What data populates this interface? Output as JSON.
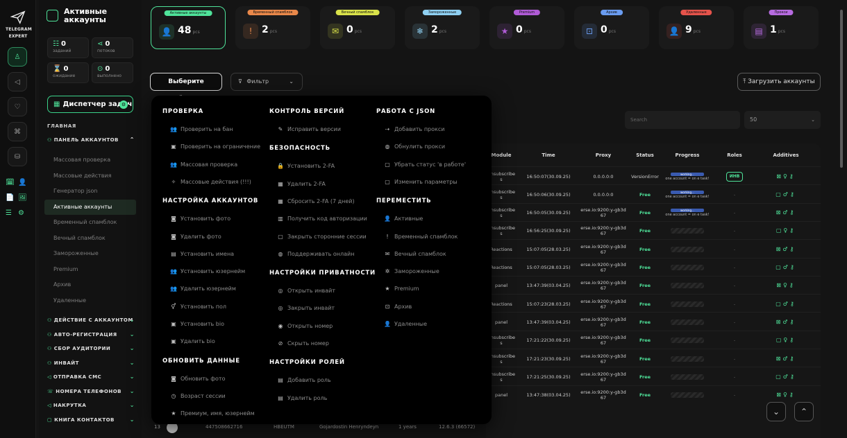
{
  "rail": {
    "logo_text": [
      "TELEGRAM",
      "EXPERT"
    ],
    "mini_left": [
      "🗓",
      "📄",
      "☰"
    ],
    "mini_right": [
      "👤",
      "🖼",
      "⚙"
    ]
  },
  "sidebar": {
    "title_line1": "Активные",
    "title_line2": "аккаунты",
    "stats": [
      {
        "icon": "☷",
        "value": "0",
        "label": "заданий"
      },
      {
        "icon": "⋖",
        "value": "0",
        "label": "потоков"
      },
      {
        "icon": "⌛",
        "value": "0",
        "label": "ожидание"
      },
      {
        "icon": "⊙",
        "value": "0",
        "label": "выполнено"
      }
    ],
    "dispatcher": "Диспетчер задач",
    "dispatcher_badge": "⚙",
    "section_main": "ГЛАВНАЯ",
    "panel_group": "ПАНЕЛЬ АККАУНТОВ",
    "panel_items": [
      "Массовая проверка",
      "Массовые действия",
      "Генератор json",
      "Активные аккаунты",
      "Временный спамблок",
      "Вечный спамблок",
      "Замороженные",
      "Premium",
      "Архив",
      "Удаленные"
    ],
    "groups": [
      "ДЕЙСТВИЕ С АККАУНТОМ",
      "АВТО-РЕГИСТРАЦИЯ",
      "СБОР АУДИТОРИИ",
      "ИНВАЙТ",
      "ОТПРАВКА СМС",
      "НОМЕРА ТЕЛЕФОНОВ",
      "НАКРУТКА",
      "КНИГА КОНТАКТОВ"
    ]
  },
  "cards": [
    {
      "label": "Активные аккаунты",
      "count": "48",
      "unit": "pcs",
      "color": "#4fe39a",
      "icon": "👤"
    },
    {
      "label": "Временный спамблок",
      "count": "2",
      "unit": "pcs",
      "color": "#e9884a",
      "icon": "!"
    },
    {
      "label": "Вечный спамблок",
      "count": "0",
      "unit": "pcs",
      "color": "#d9e24a",
      "icon": "✉"
    },
    {
      "label": "Замороженные",
      "count": "2",
      "unit": "pcs",
      "color": "#8fd0f2",
      "icon": "❄"
    },
    {
      "label": "Premium",
      "count": "0",
      "unit": "pcs",
      "color": "#b05bd6",
      "icon": "★"
    },
    {
      "label": "Архив",
      "count": "0",
      "unit": "pcs",
      "color": "#6a9cf0",
      "icon": "⊡"
    },
    {
      "label": "Удаленные",
      "count": "9",
      "unit": "pcs",
      "color": "#e5534b",
      "icon": "👤"
    },
    {
      "label": "Прокси",
      "count": "1",
      "unit": "pcs",
      "color": "#b76be0",
      "icon": "▤"
    }
  ],
  "toolbar": {
    "action": "Выберите действие",
    "filter": "Фильтр",
    "upload": "Загрузить аккаунты",
    "search_placeholder": "Search",
    "per_page": "50"
  },
  "table": {
    "headers": [
      "Module",
      "Time",
      "Proxy",
      "Status",
      "Progress",
      "Roles",
      "Additives"
    ],
    "rows": [
      {
        "module": "Unsubscribe s",
        "time": "16:50:07(30.09.25)",
        "proxy": "0.0.0.0:0",
        "status": "VersionError",
        "progress": "working",
        "role": "ИНВ"
      },
      {
        "module": "Unsubscribe s",
        "time": "16:50:06(30.09.25)",
        "proxy": "0.0.0.0:0",
        "status": "Free",
        "progress": "working",
        "role": "-"
      },
      {
        "module": "Unsubscribe s",
        "time": "16:50:05(30.09.25)",
        "proxy": "erse.io:9200:y-gb3d 67",
        "status": "Free",
        "progress": "working",
        "role": "-"
      },
      {
        "module": "Unsubscribe s",
        "time": "16:56:25(30.09.25)",
        "proxy": "erse.io:9200:y-gb3d 67",
        "status": "Free",
        "progress": "",
        "role": "-"
      },
      {
        "module": "Reactions",
        "time": "15:07:05(28.03.25)",
        "proxy": "erse.io:9200:y-gb3d 67",
        "status": "Free",
        "progress": "",
        "role": "-"
      },
      {
        "module": "Reactions",
        "time": "15:07:05(28.03.25)",
        "proxy": "erse.io:9200:y-gb3d 67",
        "status": "Free",
        "progress": "",
        "role": "-"
      },
      {
        "module": "panel",
        "time": "13:47:39(03.04.25)",
        "proxy": "erse.io:9200:y-gb3d 67",
        "status": "Free",
        "progress": "",
        "role": "-"
      },
      {
        "module": "Reactions",
        "time": "15:07:23(28.03.25)",
        "proxy": "erse.io:9200:y-gb3d 67",
        "status": "Free",
        "progress": "",
        "role": "-"
      },
      {
        "module": "panel",
        "time": "13:47:39(03.04.25)",
        "proxy": "erse.io:9200:y-gb3d 67",
        "status": "Free",
        "progress": "",
        "role": "-"
      },
      {
        "module": "Unsubscribe s",
        "time": "17:21:22(30.09.25)",
        "proxy": "erse.io:9200:y-gb3d 67",
        "status": "Free",
        "progress": "",
        "role": "-"
      },
      {
        "module": "Unsubscribe s",
        "time": "17:21:23(30.09.25)",
        "proxy": "erse.io:9200:y-gb3d 67",
        "status": "Free",
        "progress": "",
        "role": "-"
      },
      {
        "module": "Unsubscribe s",
        "time": "17:21:25(30.09.25)",
        "proxy": "erse.io:9200:y-gb3d 67",
        "status": "Free",
        "progress": "",
        "role": "-"
      },
      {
        "module": "panel",
        "time": "13:47:38(03.04.25)",
        "proxy": "erse.io:9200:y-gb3d 67",
        "status": "Free",
        "progress": "",
        "role": "-"
      }
    ],
    "working_label": "working...",
    "working_text": "one account = on e task!",
    "last_row": {
      "num": "13",
      "id": "447508662716",
      "code": "HBEUTM",
      "name": "Gojardostin Henryndeyn",
      "age": "1 years",
      "version": "12.6.3 (66572)"
    }
  },
  "menu": {
    "columns": [
      {
        "sections": [
          {
            "title": "ПРОВЕРКА",
            "items": [
              [
                "Проверить на бан",
                "👥"
              ],
              [
                "Проверить на ограничение",
                "▣"
              ],
              [
                "Массовая проверка",
                "👥"
              ],
              [
                "Массовые действия (!!!)",
                "✧"
              ]
            ]
          },
          {
            "title": "НАСТРОЙКА АККАУНТОВ",
            "items": [
              [
                "Установить фото",
                "◙"
              ],
              [
                "Удалить фото",
                "◙"
              ],
              [
                "Установить имена",
                "▤"
              ],
              [
                "Установить юзернейм",
                "👥"
              ],
              [
                "Удалить юзернейм",
                "👥"
              ],
              [
                "Установить пол",
                "⚥"
              ],
              [
                "Установить bio",
                "▣"
              ],
              [
                "Удалить bio",
                "▣"
              ]
            ]
          },
          {
            "title": "ОБНОВИТЬ ДАННЫЕ",
            "items": [
              [
                "Обновить фото",
                "◙"
              ],
              [
                "Возраст сессии",
                "◷"
              ],
              [
                "Премиум, имя, юзернейм",
                "★"
              ]
            ]
          }
        ]
      },
      {
        "sections": [
          {
            "title": "КОНТРОЛЬ ВЕРСИЙ",
            "items": [
              [
                "Исправить версии",
                "✎"
              ]
            ]
          },
          {
            "title": "БЕЗОПАСНОСТЬ",
            "items": [
              [
                "Установить 2-FA",
                "🔒"
              ],
              [
                "Удалить 2-FA",
                "▦"
              ],
              [
                "Сбросить 2-FA (7 дней)",
                "▦"
              ],
              [
                "Получить код авторизации",
                "▥"
              ],
              [
                "Закрыть сторонние сессии",
                "▢"
              ],
              [
                "Поддерживать онлайн",
                "◍"
              ]
            ]
          },
          {
            "title": "НАСТРОЙКИ ПРИВАТНОСТИ",
            "items": [
              [
                "Открыть инвайт",
                "◎"
              ],
              [
                "Закрыть инвайт",
                "◎"
              ],
              [
                "Открыть номер",
                "◉"
              ],
              [
                "Скрыть номер",
                "⊘"
              ]
            ]
          },
          {
            "title": "НАСТРОЙКИ РОЛЕЙ",
            "items": [
              [
                "Добавить роль",
                "▤"
              ],
              [
                "Удалить роль",
                "▤"
              ]
            ]
          }
        ]
      },
      {
        "sections": [
          {
            "title": "РАБОТА С JSON",
            "items": [
              [
                "Добавить прокси",
                "⇢"
              ],
              [
                "Обнулить прокси",
                "◍"
              ],
              [
                "Убрать статус 'в работе'",
                "▢"
              ],
              [
                "Изменить параметры",
                "▢"
              ]
            ]
          },
          {
            "title": "ПЕРЕМЕСТИТЬ",
            "items": [
              [
                "Активные",
                "👤"
              ],
              [
                "Временный спамблок",
                "!"
              ],
              [
                "Вечный спамблок",
                "✉"
              ],
              [
                "Замороженные",
                "✲"
              ],
              [
                "Premium",
                "★"
              ],
              [
                "Архив",
                "⊡"
              ],
              [
                "Удаленные",
                "👤"
              ]
            ]
          }
        ]
      }
    ]
  }
}
